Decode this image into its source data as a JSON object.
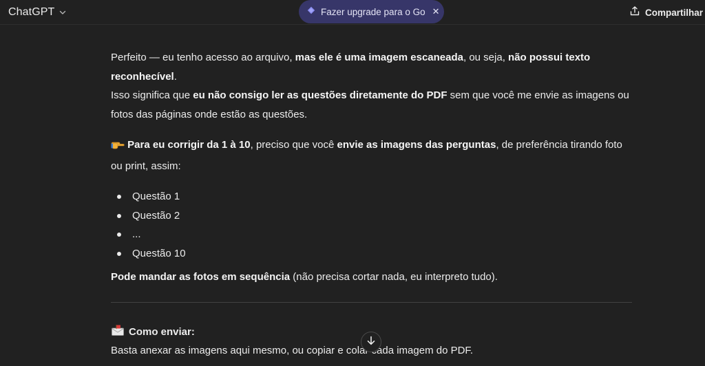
{
  "header": {
    "model_name": "ChatGPT",
    "upgrade_label": "Fazer upgrade para o Go",
    "close_glyph": "✕",
    "share_label": "Compartilhar"
  },
  "message": {
    "p1": {
      "t1": "Perfeito — eu tenho acesso ao arquivo, ",
      "b1": "mas ele é uma imagem escaneada",
      "t2": ", ou seja, ",
      "b2": "não possui texto reconhecível",
      "t3": "."
    },
    "p1b": {
      "t1": "Isso significa que ",
      "b1": "eu não consigo ler as questões diretamente do PDF",
      "t2": " sem que você me envie as imagens ou fotos das páginas onde estão as questões."
    },
    "p2": {
      "b1": "Para eu corrigir da 1 à 10",
      "t1": ", preciso que você ",
      "b2": "envie as imagens das perguntas",
      "t2": ", de preferência tirando foto ou print, assim:"
    },
    "list": [
      "Questão 1",
      "Questão 2",
      "...",
      "Questão 10"
    ],
    "p3": {
      "b1": "Pode mandar as fotos em sequência",
      "t1": " (não precisa cortar nada, eu interpreto tudo)."
    },
    "how_title": "Como enviar:",
    "how_text": "Basta anexar as imagens aqui mesmo, ou copiar e colar cada imagem do PDF."
  },
  "icons": {
    "chevron": "chevron-down-icon",
    "diamond": "diamond-icon",
    "share": "share-icon",
    "pointing": "pointing-hand-icon",
    "mail": "envelope-icon",
    "scroll": "arrow-down-icon"
  },
  "colors": {
    "background": "#212121",
    "pill": "#373669",
    "diamond": "#8a8cf0"
  }
}
